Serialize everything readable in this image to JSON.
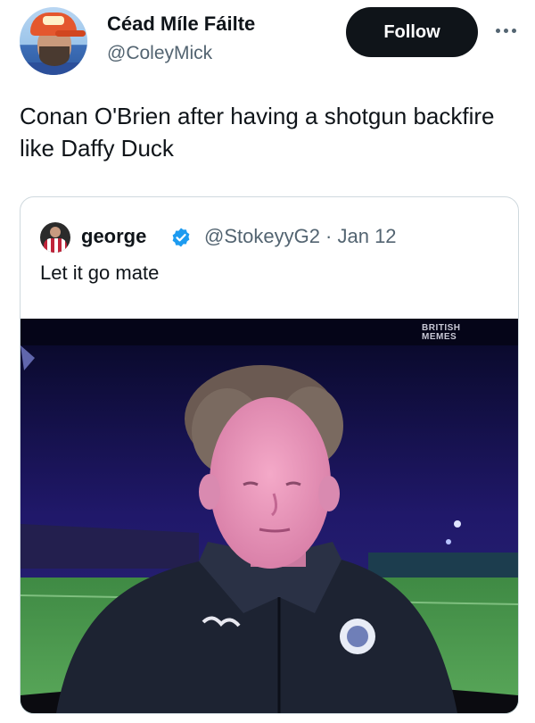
{
  "tweet": {
    "author": {
      "display_name": "Céad Míle Fáilte",
      "handle": "@ColeyMick",
      "avatar_icon": "user-avatar-icon"
    },
    "follow_label": "Follow",
    "more_icon": "more-horizontal-icon",
    "text": "Conan O'Brien after having a shotgun backfire like Daffy Duck"
  },
  "quoted_tweet": {
    "author": {
      "display_name": "george",
      "handle_date": "@StokeyyG2 · Jan 12",
      "verified_icon": "verified-badge-icon",
      "avatar_icon": "user-avatar-icon"
    },
    "text": "Let it go mate",
    "media": {
      "type": "photo",
      "watermark": "BRITISH\nMEMES"
    }
  },
  "colors": {
    "text_primary": "#0f1419",
    "text_secondary": "#536471",
    "follow_bg": "#0f1419",
    "verified": "#1d9bf0",
    "border": "#cfd9de"
  }
}
